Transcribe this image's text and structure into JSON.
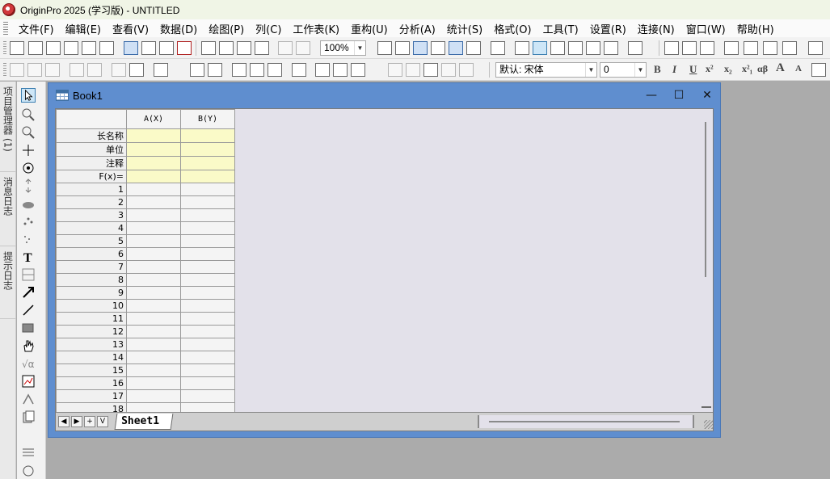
{
  "window": {
    "title": "OriginPro 2025 (学习版) - UNTITLED"
  },
  "menu": [
    {
      "label": "文件(F)"
    },
    {
      "label": "编辑(E)"
    },
    {
      "label": "查看(V)"
    },
    {
      "label": "数据(D)"
    },
    {
      "label": "绘图(P)"
    },
    {
      "label": "列(C)"
    },
    {
      "label": "工作表(K)"
    },
    {
      "label": "重构(U)"
    },
    {
      "label": "分析(A)"
    },
    {
      "label": "统计(S)"
    },
    {
      "label": "格式(O)"
    },
    {
      "label": "工具(T)"
    },
    {
      "label": "设置(R)"
    },
    {
      "label": "连接(N)"
    },
    {
      "label": "窗口(W)"
    },
    {
      "label": "帮助(H)"
    }
  ],
  "toolbar": {
    "zoom": "100%",
    "font_name": "默认: 宋体",
    "font_size": "0",
    "bold": "B",
    "italic": "I",
    "underline": "U",
    "superscript": "x²",
    "subscript": "x₂",
    "super_sub": "x²₁",
    "greek": "αβ",
    "grow_font": "A",
    "shrink_font": "A"
  },
  "left_tabs": [
    {
      "label": "项目管理器 (1)"
    },
    {
      "label": "消息日志"
    },
    {
      "label": "提示日志"
    }
  ],
  "book": {
    "title": "Book1",
    "columns": [
      "A(X)",
      "B(Y)"
    ],
    "meta_rows": [
      "长名称",
      "单位",
      "注释",
      "F(x)="
    ],
    "rows": [
      "1",
      "2",
      "3",
      "4",
      "5",
      "6",
      "7",
      "8",
      "9",
      "10",
      "11",
      "12",
      "13",
      "14",
      "15",
      "16",
      "17",
      "18"
    ],
    "sheet_tab": "Sheet1"
  },
  "colors": {
    "book_frame": "#5f8ecf",
    "meta_cell": "#fafac8",
    "workspace": "#ababab"
  }
}
